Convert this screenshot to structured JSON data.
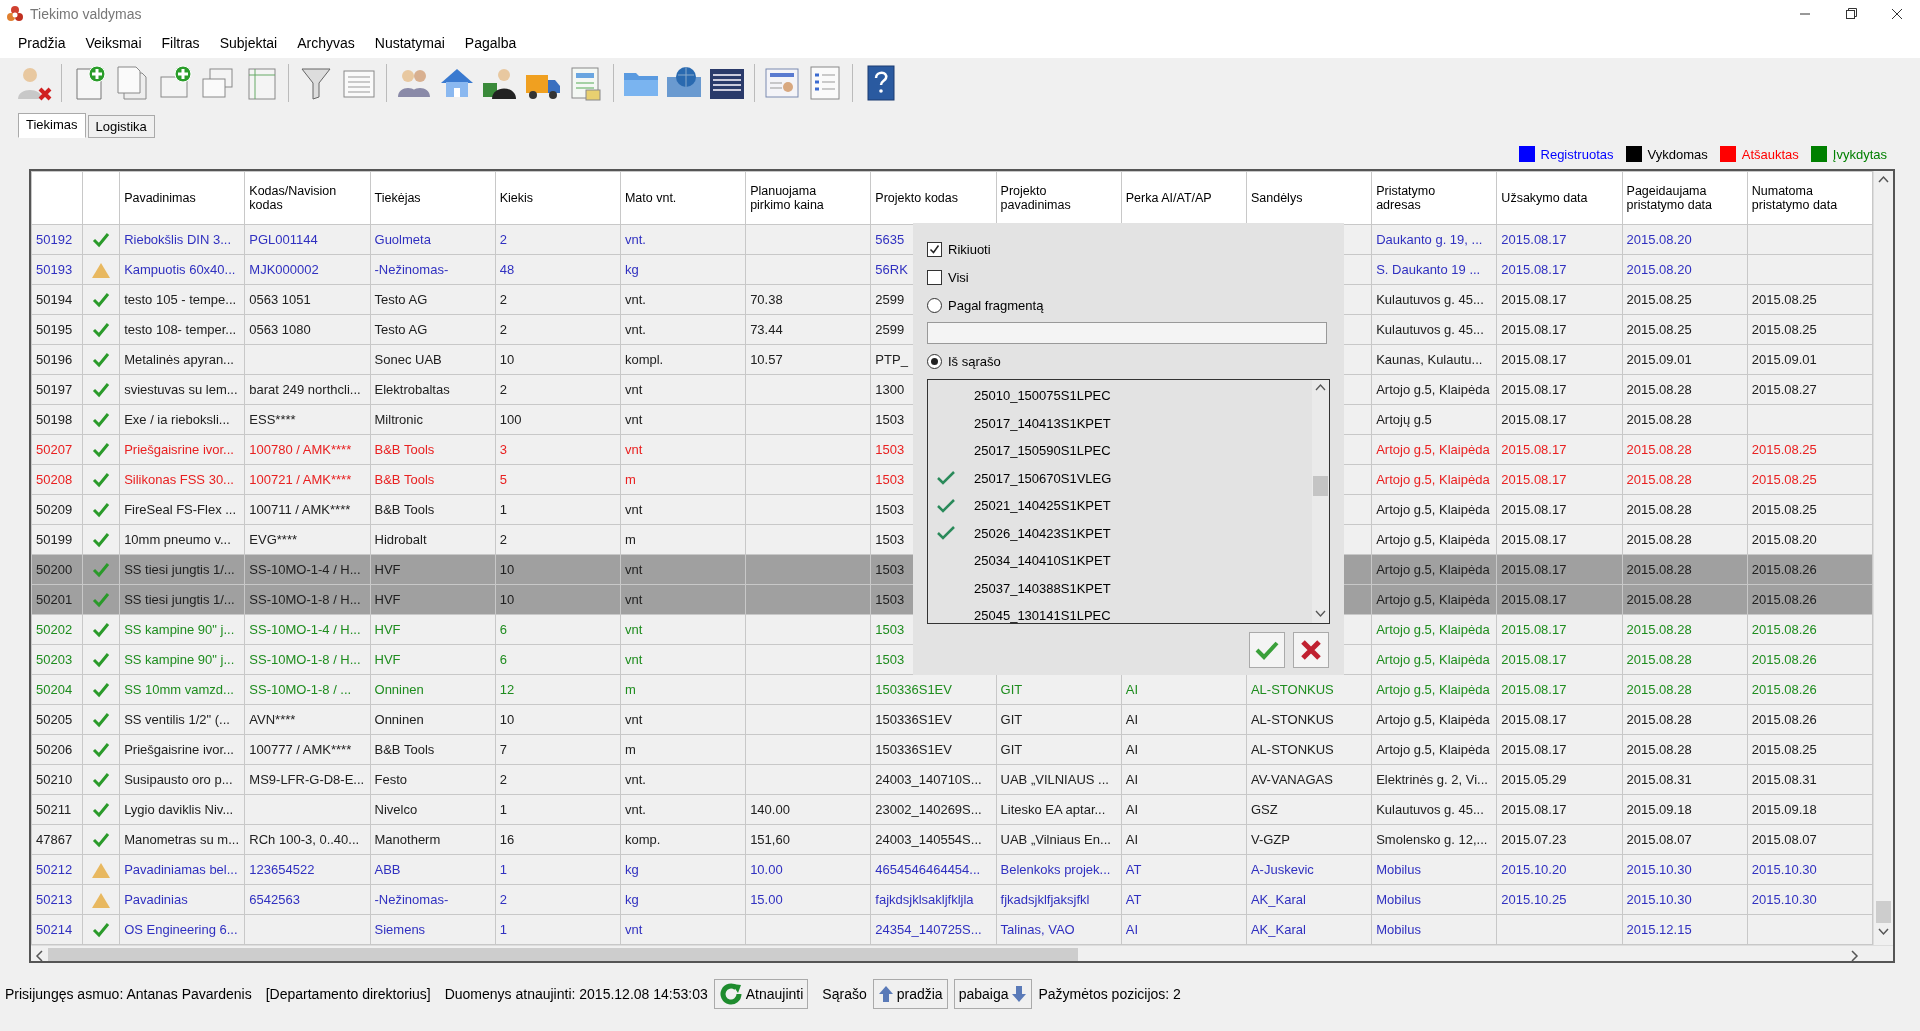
{
  "window": {
    "title": "Tiekimo valdymas"
  },
  "menu": [
    "Pradžia",
    "Veiksmai",
    "Filtras",
    "Subjektai",
    "Archyvas",
    "Nustatymai",
    "Pagalba"
  ],
  "tabs": [
    {
      "label": "Tiekimas",
      "selected": true
    },
    {
      "label": "Logistika",
      "selected": false
    }
  ],
  "legend": [
    {
      "label": "Registruotas",
      "color": "#0000ff"
    },
    {
      "label": "Vykdomas",
      "color": "#000000"
    },
    {
      "label": "Atšauktas",
      "color": "#ff0000"
    },
    {
      "label": "Įvykdytas",
      "color": "#008000"
    }
  ],
  "table": {
    "columns": [
      "Pavadinimas",
      "Kodas/Navision kodas",
      "Tiekėjas",
      "Kiekis",
      "Mato vnt.",
      "Planuojama pirkimo kaina",
      "Projekto kodas",
      "Projekto pavadinimas",
      "Perka AI/AT/AP",
      "Sandėlys",
      "Pristatymo adresas",
      "Užsakymo data",
      "Pageidaujama pristatymo data",
      "Numatoma pristatymo data"
    ],
    "rows": [
      {
        "id": "50192",
        "kind": "ok",
        "color": "#3030c0",
        "selected": false,
        "cells": [
          "Riebokšlis DIN 3...",
          "PGL001144",
          "Guolmeta",
          "2",
          "vnt.",
          null,
          "5635",
          null,
          null,
          null,
          "Daukanto g. 19, ...",
          "2015.08.17",
          "2015.08.20",
          null
        ]
      },
      {
        "id": "50193",
        "kind": "warning",
        "color": "#3030c0",
        "selected": false,
        "cells": [
          "Kampuotis 60x40...",
          "MJK000002",
          "-Nežinomas-",
          "48",
          "kg",
          null,
          "56RK",
          null,
          null,
          null,
          "S. Daukanto 19 ...",
          "2015.08.17",
          "2015.08.20",
          null
        ]
      },
      {
        "id": "50194",
        "kind": "ok",
        "color": "#202020",
        "selected": false,
        "cells": [
          "testo 105 - tempe...",
          "0563 1051",
          "Testo AG",
          "2",
          "vnt.",
          "70.38",
          "2599",
          null,
          null,
          null,
          "Kulautuvos g. 45...",
          "2015.08.17",
          "2015.08.25",
          "2015.08.25"
        ]
      },
      {
        "id": "50195",
        "kind": "ok",
        "color": "#202020",
        "selected": false,
        "cells": [
          "testo 108- temper...",
          "0563 1080",
          "Testo AG",
          "2",
          "vnt.",
          "73.44",
          "2599",
          null,
          null,
          null,
          "Kulautuvos g. 45...",
          "2015.08.17",
          "2015.08.25",
          "2015.08.25"
        ]
      },
      {
        "id": "50196",
        "kind": "ok",
        "color": "#202020",
        "selected": false,
        "cells": [
          "Metalinės apyran...",
          null,
          "Sonec UAB",
          "10",
          "kompl.",
          "10.57",
          "PTP_",
          null,
          null,
          null,
          "Kaunas, Kulautu...",
          "2015.08.17",
          "2015.09.01",
          "2015.09.01"
        ]
      },
      {
        "id": "50197",
        "kind": "ok",
        "color": "#202020",
        "selected": false,
        "cells": [
          "sviestuvas su lem...",
          "barat 249 northcli...",
          "Elektrobaltas",
          "2",
          "vnt",
          null,
          "1300",
          null,
          null,
          null,
          "Artojo g.5, Klaipėda",
          "2015.08.17",
          "2015.08.28",
          "2015.08.27"
        ]
      },
      {
        "id": "50198",
        "kind": "ok",
        "color": "#202020",
        "selected": false,
        "cells": [
          "Exe / ia rieboksli...",
          "ESS****",
          "Miltronic",
          "100",
          "vnt",
          null,
          "1503",
          null,
          null,
          null,
          "Artojų g.5",
          "2015.08.17",
          "2015.08.28",
          null
        ]
      },
      {
        "id": "50207",
        "kind": "ok",
        "color": "#e82020",
        "selected": false,
        "cells": [
          "Priešgaisrine ivor...",
          "100780  / AMK****",
          "B&B Tools",
          "3",
          "vnt",
          null,
          "1503",
          null,
          null,
          null,
          "Artojo g.5, Klaipėda",
          "2015.08.17",
          "2015.08.28",
          "2015.08.25"
        ]
      },
      {
        "id": "50208",
        "kind": "ok",
        "color": "#e82020",
        "selected": false,
        "cells": [
          "Silikonas FSS 30...",
          "100721 / AMK****",
          "B&B Tools",
          "5",
          "m",
          null,
          "1503",
          null,
          null,
          null,
          "Artojo g.5, Klaipėda",
          "2015.08.17",
          "2015.08.28",
          "2015.08.25"
        ]
      },
      {
        "id": "50209",
        "kind": "ok",
        "color": "#202020",
        "selected": false,
        "cells": [
          "FireSeal FS-Flex ...",
          "100711  / AMK****",
          "B&B Tools",
          "1",
          "vnt",
          null,
          "1503",
          null,
          null,
          null,
          "Artojo g.5, Klaipėda",
          "2015.08.17",
          "2015.08.28",
          "2015.08.25"
        ]
      },
      {
        "id": "50199",
        "kind": "ok",
        "color": "#202020",
        "selected": false,
        "cells": [
          "10mm pneumo v...",
          "EVG****",
          "Hidrobalt",
          "2",
          "m",
          null,
          "1503",
          null,
          null,
          null,
          "Artojo g.5, Klaipėda",
          "2015.08.17",
          "2015.08.28",
          "2015.08.20"
        ]
      },
      {
        "id": "50200",
        "kind": "ok",
        "color": "#202020",
        "selected": true,
        "cells": [
          "SS tiesi jungtis 1/...",
          "SS-10MO-1-4 / H...",
          "HVF",
          "10",
          "vnt",
          null,
          "1503",
          null,
          null,
          null,
          "Artojo g.5, Klaipėda",
          "2015.08.17",
          "2015.08.28",
          "2015.08.26"
        ]
      },
      {
        "id": "50201",
        "kind": "ok",
        "color": "#202020",
        "selected": true,
        "cells": [
          "SS tiesi jungtis 1/...",
          "SS-10MO-1-8 / H...",
          "HVF",
          "10",
          "vnt",
          null,
          "1503",
          null,
          null,
          null,
          "Artojo g.5, Klaipėda",
          "2015.08.17",
          "2015.08.28",
          "2015.08.26"
        ]
      },
      {
        "id": "50202",
        "kind": "ok",
        "color": "#1e8c1e",
        "selected": false,
        "cells": [
          "SS kampine 90\" j...",
          "SS-10MO-1-4 / H...",
          "HVF",
          "6",
          "vnt",
          null,
          "1503",
          null,
          null,
          null,
          "Artojo g.5, Klaipėda",
          "2015.08.17",
          "2015.08.28",
          "2015.08.26"
        ]
      },
      {
        "id": "50203",
        "kind": "ok",
        "color": "#1e8c1e",
        "selected": false,
        "cells": [
          "SS kampine 90\" j...",
          "SS-10MO-1-8 / H...",
          "HVF",
          "6",
          "vnt",
          null,
          "1503",
          null,
          null,
          null,
          "Artojo g.5, Klaipėda",
          "2015.08.17",
          "2015.08.28",
          "2015.08.26"
        ]
      },
      {
        "id": "50204",
        "kind": "ok",
        "color": "#1e8c1e",
        "selected": false,
        "cells": [
          "SS 10mm vamzd...",
          "SS-10MO-1-8 / ...",
          "Onninen",
          "12",
          "m",
          null,
          "150336S1EV",
          "GIT",
          "AI",
          "AL-STONKUS",
          "Artojo g.5, Klaipėda",
          "2015.08.17",
          "2015.08.28",
          "2015.08.26"
        ]
      },
      {
        "id": "50205",
        "kind": "ok",
        "color": "#202020",
        "selected": false,
        "cells": [
          "SS ventilis 1/2\" (...",
          "AVN****",
          "Onninen",
          "10",
          "vnt",
          null,
          "150336S1EV",
          "GIT",
          "AI",
          "AL-STONKUS",
          "Artojo g.5, Klaipėda",
          "2015.08.17",
          "2015.08.28",
          "2015.08.26"
        ]
      },
      {
        "id": "50206",
        "kind": "ok",
        "color": "#202020",
        "selected": false,
        "cells": [
          "Priešgaisrine ivor...",
          "100777 / AMK****",
          "B&B Tools",
          "7",
          "m",
          null,
          "150336S1EV",
          "GIT",
          "AI",
          "AL-STONKUS",
          "Artojo g.5, Klaipėda",
          "2015.08.17",
          "2015.08.28",
          "2015.08.25"
        ]
      },
      {
        "id": "50210",
        "kind": "ok",
        "color": "#202020",
        "selected": false,
        "cells": [
          "Susipausto oro p...",
          "MS9-LFR-G-D8-E...",
          "Festo",
          "2",
          "vnt.",
          null,
          "24003_140710S...",
          "UAB „VILNIAUS ...",
          "AI",
          "AV-VANAGAS",
          "Elektrinės g. 2, Vi...",
          "2015.05.29",
          "2015.08.31",
          "2015.08.31"
        ]
      },
      {
        "id": "50211",
        "kind": "ok",
        "color": "#202020",
        "selected": false,
        "cells": [
          "Lygio daviklis Niv...",
          null,
          "Nivelco",
          "1",
          "vnt.",
          "140.00",
          "23002_140269S...",
          "Litesko EA aptar...",
          "AI",
          "GSZ",
          "Kulautuvos g. 45...",
          "2015.08.17",
          "2015.09.18",
          "2015.09.18"
        ]
      },
      {
        "id": "47867",
        "kind": "ok",
        "color": "#202020",
        "selected": false,
        "cells": [
          "Manometras su m...",
          "RCh 100-3, 0..40...",
          "Manotherm",
          "16",
          "komp.",
          "151,60",
          "24003_140554S...",
          "UAB „Vilniaus En...",
          "AI",
          "V-GZP",
          "Smolensko g. 12,...",
          "2015.07.23",
          "2015.08.07",
          "2015.08.07"
        ]
      },
      {
        "id": "50212",
        "kind": "warning",
        "color": "#3030c0",
        "selected": false,
        "cells": [
          "Pavadiniamas bel...",
          "123654522",
          "ABB",
          "1",
          "kg",
          "10.00",
          "4654546464454...",
          "Belenkoks projek...",
          "AT",
          "A-Juskevic",
          "Mobilus",
          "2015.10.20",
          "2015.10.30",
          "2015.10.30"
        ]
      },
      {
        "id": "50213",
        "kind": "warning",
        "color": "#3030c0",
        "selected": false,
        "cells": [
          "Pavadinias",
          "6542563",
          "-Nežinomas-",
          "2",
          "kg",
          "15.00",
          "fajkdsjklsakljfkljla",
          "fjkadsjklfjaksjfkl",
          "AT",
          "AK_Karal",
          "Mobilus",
          "2015.10.25",
          "2015.10.30",
          "2015.10.30"
        ]
      },
      {
        "id": "50214",
        "kind": "ok",
        "color": "#3030c0",
        "selected": false,
        "cells": [
          "OS Engineering 6...",
          null,
          "Siemens",
          "1",
          "vnt",
          null,
          "24354_140725S...",
          "Talinas, VAO",
          "AI",
          "AK_Karal",
          "Mobilus",
          null,
          "2015.12.15",
          null
        ]
      }
    ]
  },
  "filter_popup": {
    "options": [
      {
        "kind": "checkbox",
        "label": "Rikiuoti",
        "checked": true
      },
      {
        "kind": "checkbox",
        "label": "Visi",
        "checked": false
      },
      {
        "kind": "radio",
        "label": "Pagal fragmentą",
        "selected": false
      },
      {
        "kind": "field"
      },
      {
        "kind": "radio",
        "label": "Iš sąrašo",
        "selected": true
      }
    ],
    "items": [
      {
        "label": "25010_150075S1LPEC",
        "checked": false
      },
      {
        "label": "25017_140413S1KPET",
        "checked": false
      },
      {
        "label": "25017_150590S1LPEC",
        "checked": false
      },
      {
        "label": "25017_150670S1VLEG",
        "checked": true
      },
      {
        "label": "25021_140425S1KPET",
        "checked": true
      },
      {
        "label": "25026_140423S1KPET",
        "checked": true
      },
      {
        "label": "25034_140410S1KPET",
        "checked": false
      },
      {
        "label": "25037_140388S1KPET",
        "checked": false
      },
      {
        "label": "25045_130141S1LPEC",
        "checked": false
      }
    ]
  },
  "status_bar": {
    "user": "Prisijungęs asmuo: Antanas Pavardenis",
    "role": "[Departamento direktorius]",
    "updated": "Duomenys atnaujinti: 2015.12.08 14:53:03",
    "refresh_button": "Atnaujinti",
    "list_label": "Sąrašo",
    "start_button": "pradžia",
    "end_button": "pabaiga",
    "marked": "Pažymėtos pozicijos: 2"
  }
}
